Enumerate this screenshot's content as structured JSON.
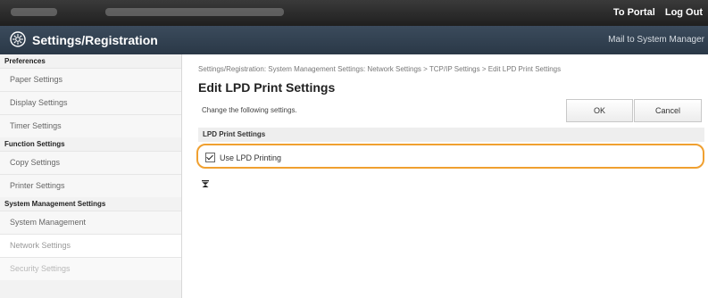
{
  "header": {
    "links": [
      "To Portal",
      "Log Out"
    ]
  },
  "titlebar": {
    "title": "Settings/Registration",
    "mail": "Mail to System Manager",
    "icon": "settings-gear-icon"
  },
  "sidebar": {
    "sections": [
      {
        "label": "Preferences",
        "items": [
          "Paper Settings",
          "Display Settings",
          "Timer Settings"
        ]
      },
      {
        "label": "Function Settings",
        "items": [
          "Copy Settings",
          "Printer Settings"
        ]
      },
      {
        "label": "System Management Settings",
        "items": [
          "System Management",
          "Network Settings",
          "Security Settings"
        ]
      }
    ]
  },
  "main": {
    "breadcrumb": "Settings/Registration: System Management Settings: Network Settings > TCP/IP Settings > Edit LPD Print Settings",
    "title": "Edit LPD Print Settings",
    "hint": "Change the following settings.",
    "ok_label": "OK",
    "cancel_label": "Cancel",
    "section_title": "LPD Print Settings",
    "checkbox_label": "Use LPD Printing",
    "checkbox_checked": true,
    "highlight_color": "#f0a030"
  }
}
